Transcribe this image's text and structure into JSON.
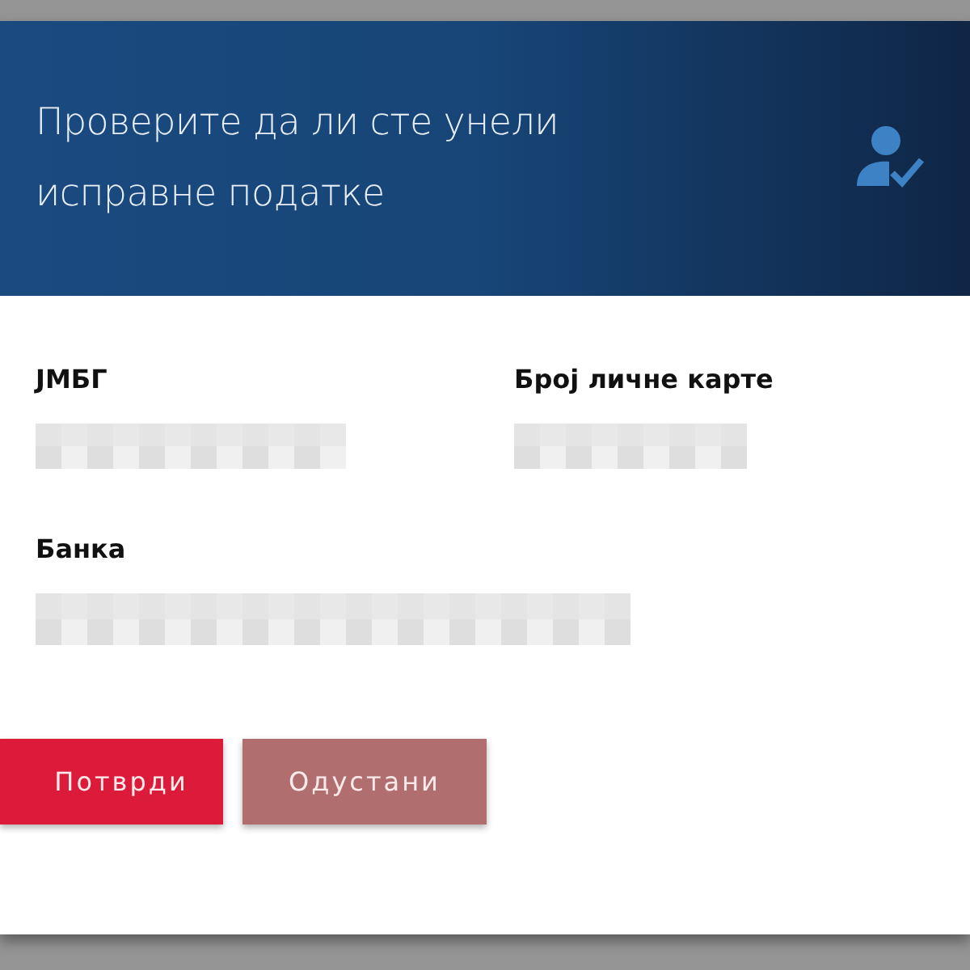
{
  "header": {
    "title": "Проверите да ли сте унели исправне податке"
  },
  "fields": [
    {
      "label": "ЈМБГ"
    },
    {
      "label": "Број личне карте"
    },
    {
      "label": "Банка"
    }
  ],
  "buttons": [
    {
      "label": "Потврди",
      "kind": "primary"
    },
    {
      "label": "Одустани",
      "kind": "secondary"
    }
  ]
}
